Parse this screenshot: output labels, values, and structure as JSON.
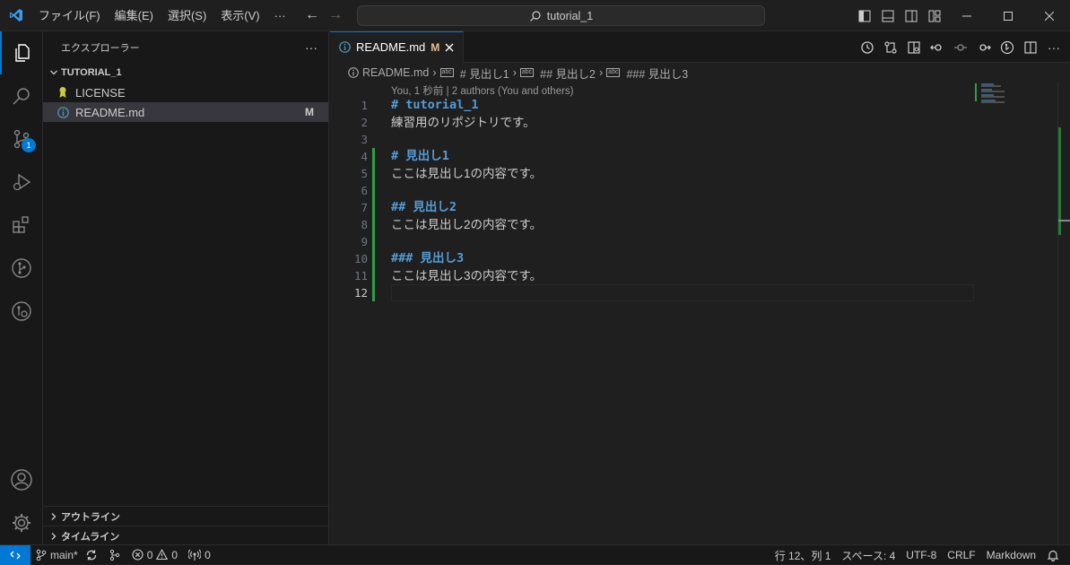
{
  "titlebar": {
    "menu": [
      "ファイル(F)",
      "編集(E)",
      "選択(S)",
      "表示(V)",
      "···"
    ],
    "search": "tutorial_1"
  },
  "activity": {
    "scm_badge": "1"
  },
  "sidebar": {
    "title": "エクスプローラー",
    "more": "···",
    "folder": "TUTORIAL_1",
    "files": [
      {
        "name": "LICENSE",
        "status": ""
      },
      {
        "name": "README.md",
        "status": "M"
      }
    ],
    "outline": "アウトライン",
    "timeline": "タイムライン"
  },
  "editor": {
    "tab": {
      "label": "README.md",
      "modified": "M"
    },
    "breadcrumb": [
      "README.md",
      "# 見出し1",
      "## 見出し2",
      "### 見出し3"
    ],
    "codelens": "You, 1 秒前 | 2 authors (You and others)",
    "lines": [
      {
        "num": "1",
        "text": "# tutorial_1",
        "heading": true
      },
      {
        "num": "2",
        "text": "練習用のリポジトリです。",
        "heading": false
      },
      {
        "num": "3",
        "text": "",
        "heading": false
      },
      {
        "num": "4",
        "text": "# 見出し1",
        "heading": true
      },
      {
        "num": "5",
        "text": "ここは見出し1の内容です。",
        "heading": false
      },
      {
        "num": "6",
        "text": "",
        "heading": false
      },
      {
        "num": "7",
        "text": "## 見出し2",
        "heading": true
      },
      {
        "num": "8",
        "text": "ここは見出し2の内容です。",
        "heading": false
      },
      {
        "num": "9",
        "text": "",
        "heading": false
      },
      {
        "num": "10",
        "text": "### 見出し3",
        "heading": true
      },
      {
        "num": "11",
        "text": "ここは見出し3の内容です。",
        "heading": false
      },
      {
        "num": "12",
        "text": "",
        "heading": false
      }
    ],
    "current_line": "12"
  },
  "statusbar": {
    "branch": "main*",
    "errors": "0",
    "warnings": "0",
    "ports": "0",
    "position": "行 12、列 1",
    "spaces": "スペース: 4",
    "encoding": "UTF-8",
    "eol": "CRLF",
    "language": "Markdown"
  },
  "colors": {
    "accent": "#0078d4",
    "added": "#2ea043",
    "modified": "#e2c08d",
    "heading": "#569cd6"
  }
}
